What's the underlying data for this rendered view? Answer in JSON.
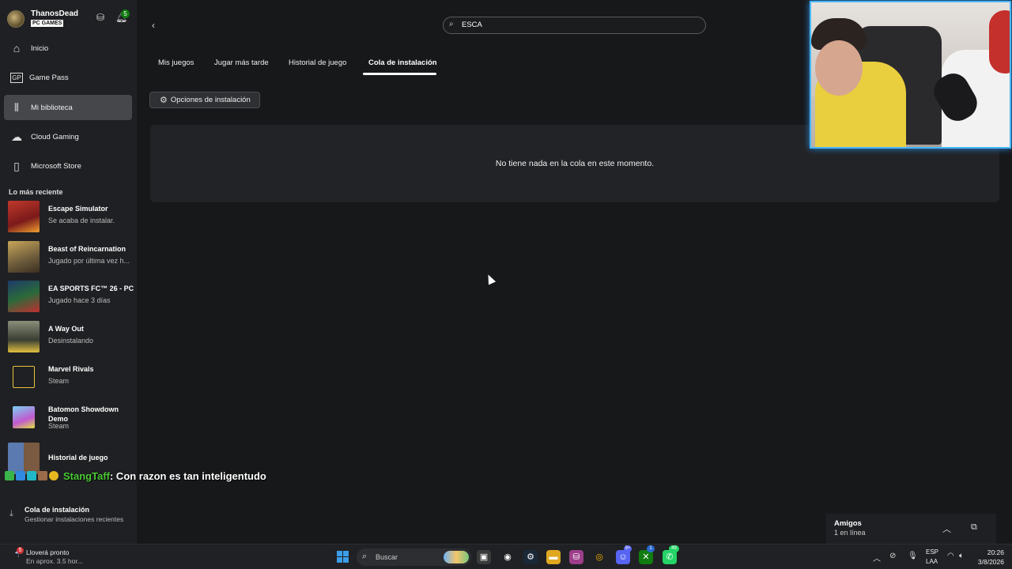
{
  "profile": {
    "name": "ThanosDead",
    "badge": "PC GAMES",
    "notifications": "5"
  },
  "nav": [
    {
      "label": "Inicio",
      "icon": "home-icon"
    },
    {
      "label": "Game Pass",
      "icon": "game-pass-icon"
    },
    {
      "label": "Mi biblioteca",
      "icon": "library-icon",
      "active": true
    },
    {
      "label": "Cloud Gaming",
      "icon": "cloud-icon"
    },
    {
      "label": "Microsoft Store",
      "icon": "store-bag-icon"
    }
  ],
  "recent": {
    "title": "Lo más reciente",
    "items": [
      {
        "name": "Escape Simulator",
        "sub": "Se acaba de instalar."
      },
      {
        "name": "Beast of Reincarnation",
        "sub": "Jugado por última vez h..."
      },
      {
        "name": "EA SPORTS FC™ 26 - PC",
        "sub": "Jugado hace 3 días"
      },
      {
        "name": "A Way Out",
        "sub": "Desinstalando"
      },
      {
        "name": "Marvel Rivals",
        "sub": "Steam"
      },
      {
        "name": "Batomon Showdown Demo",
        "sub": "Steam"
      },
      {
        "name": "Historial de juego",
        "sub": ""
      }
    ]
  },
  "queue_link": {
    "title": "Cola de instalación",
    "sub": "Gestionar instalaciones recientes"
  },
  "search": {
    "value": "ESCA"
  },
  "tabs": [
    {
      "label": "Mis juegos"
    },
    {
      "label": "Jugar más tarde"
    },
    {
      "label": "Historial de juego"
    },
    {
      "label": "Cola de instalación",
      "active": true
    }
  ],
  "options_button": {
    "label": "Opciones de instalación"
  },
  "empty_message": "No tiene nada en la cola en este momento.",
  "chat": {
    "user": "StangTaff",
    "message": ": Con razon es tan inteligentudo"
  },
  "friends": {
    "title": "Amigos",
    "sub": "1 en línea"
  },
  "taskbar": {
    "weather_title": "Lloverá pronto",
    "weather_sub": "En aprox. 3.5 hor...",
    "weather_badge": "5",
    "search_label": "Buscar",
    "discord_badge": "9+",
    "xbox_badge": "1",
    "whatsapp_badge": "49",
    "lang_1": "ESP",
    "lang_2": "LAA",
    "time": "20:26",
    "date": "3/8/2026"
  },
  "colors": {
    "accent_green": "#107c10",
    "chat_user": "#4ac934",
    "cam_border": "#49b6ff"
  }
}
